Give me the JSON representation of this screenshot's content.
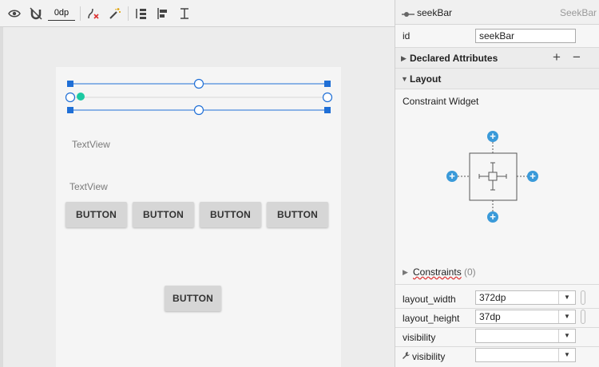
{
  "toolbar": {
    "icons": [
      "eye-icon",
      "magnet-off-icon",
      "infer-constraints-icon",
      "magic-wand-icon",
      "distribute-icon",
      "align-icon",
      "guidelines-icon"
    ],
    "margin_value": "0dp"
  },
  "canvas": {
    "textview_1": "TextView",
    "textview_2": "TextView",
    "buttons_row": [
      "BUTTON",
      "BUTTON",
      "BUTTON",
      "BUTTON"
    ],
    "button_bottom": "BUTTON"
  },
  "panel": {
    "component_name": "seekBar",
    "component_type": "SeekBar",
    "id_label": "id",
    "id_value": "seekBar",
    "declared_attributes": "Declared Attributes",
    "layout_section": "Layout",
    "constraint_widget": "Constraint Widget",
    "constraints_label": "Constraints",
    "constraints_count": "(0)",
    "attributes": [
      {
        "name": "layout_width",
        "value": "372dp"
      },
      {
        "name": "layout_height",
        "value": "37dp"
      },
      {
        "name": "visibility",
        "value": ""
      },
      {
        "name": "visibility",
        "value": ""
      }
    ],
    "add_symbol": "+",
    "remove_symbol": "−"
  },
  "colors": {
    "selection_blue": "#1f6fd6",
    "seek_thumb": "#1cc9a2",
    "constraint_plus": "#3a9ad9"
  }
}
